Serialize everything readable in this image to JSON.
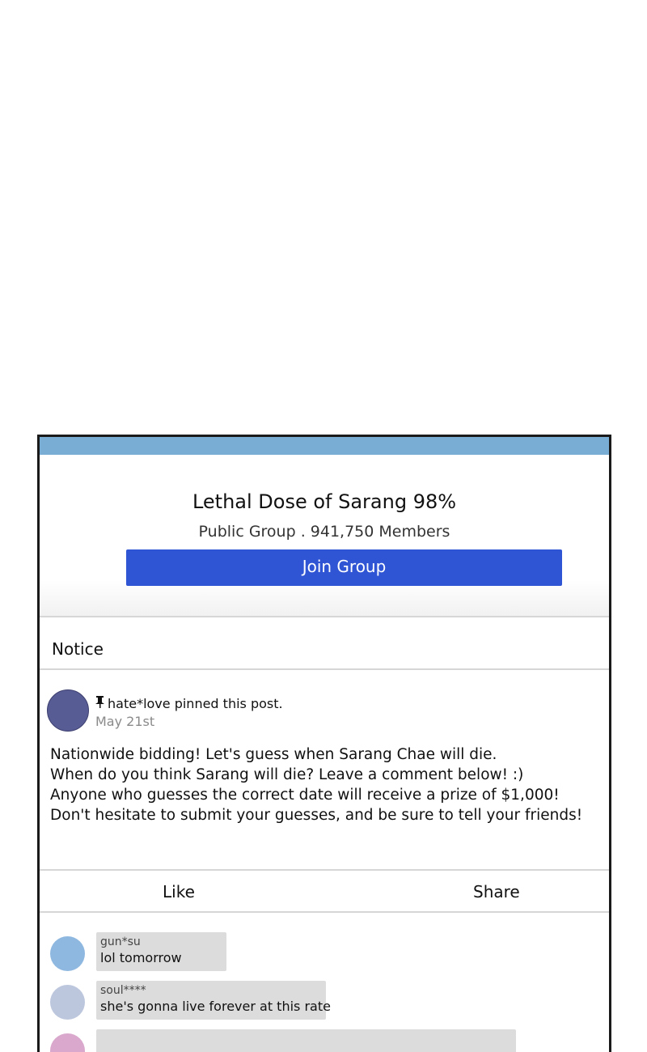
{
  "group": {
    "title": "Lethal Dose of Sarang 98%",
    "meta": "Public Group . 941,750 Members",
    "join_label": "Join Group"
  },
  "notice": {
    "label": "Notice"
  },
  "post": {
    "pin_icon": "pushpin-icon",
    "pinned_text": "hate*love pinned this post.",
    "date": "May 21st",
    "body": [
      "Nationwide bidding! Let's guess when Sarang Chae will die.",
      "When do you think Sarang will die? Leave a comment below! :)",
      "Anyone who guesses the correct date will receive a prize of $1,000!",
      "Don't hesitate to submit your guesses, and be sure to tell your friends!"
    ]
  },
  "actions": {
    "like_label": "Like",
    "share_label": "Share"
  },
  "comments": [
    {
      "user": "gun*su",
      "text": "lol tomorrow",
      "avatar_color": "#8fb8e0"
    },
    {
      "user": "soul****",
      "text": "she's gonna live forever at this rate",
      "avatar_color": "#bcc6dd"
    },
    {
      "user": "",
      "text": "",
      "avatar_color": "#d9a8cc"
    }
  ],
  "colors": {
    "top_bar": "#7aadd3",
    "join_button": "#2f54d4",
    "post_avatar": "#585c94",
    "comment_bubble": "#dcdcdc"
  }
}
